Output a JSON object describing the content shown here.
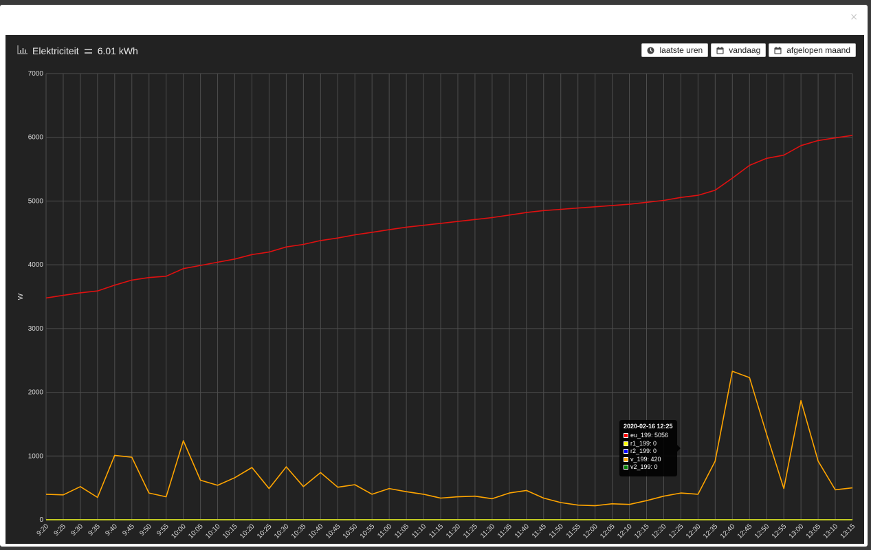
{
  "header": {
    "title": "Elektriciteit",
    "total": "6.01 kWh"
  },
  "buttons": [
    {
      "label": "laatste uren",
      "icon": "clock-icon"
    },
    {
      "label": "vandaag",
      "icon": "calendar-icon"
    },
    {
      "label": "afgelopen maand",
      "icon": "calendar-icon"
    }
  ],
  "close_label": "×",
  "tooltip": {
    "title": "2020-02-16 12:25",
    "rows": [
      {
        "label": "eu_199: 5056",
        "color": "#ff0000"
      },
      {
        "label": "r1_199: 0",
        "color": "#ffff00"
      },
      {
        "label": "r2_199: 0",
        "color": "#0000ff"
      },
      {
        "label": "v_199: 420",
        "color": "#ffa500"
      },
      {
        "label": "v2_199: 0",
        "color": "#008000"
      }
    ]
  },
  "chart_data": {
    "type": "line",
    "ylabel": "W",
    "xlabel": "",
    "ylim": [
      0,
      7000
    ],
    "yticks": [
      0,
      1000,
      2000,
      3000,
      4000,
      5000,
      6000,
      7000
    ],
    "grid": true,
    "x": [
      "9:20",
      "9:25",
      "9:30",
      "9:35",
      "9:40",
      "9:45",
      "9:50",
      "9:55",
      "10:00",
      "10:05",
      "10:10",
      "10:15",
      "10:20",
      "10:25",
      "10:30",
      "10:35",
      "10:40",
      "10:45",
      "10:50",
      "10:55",
      "11:00",
      "11:05",
      "11:10",
      "11:15",
      "11:20",
      "11:25",
      "11:30",
      "11:35",
      "11:40",
      "11:45",
      "11:50",
      "11:55",
      "12:00",
      "12:05",
      "12:10",
      "12:15",
      "12:20",
      "12:25",
      "12:30",
      "12:35",
      "12:40",
      "12:45",
      "12:50",
      "12:55",
      "13:00",
      "13:05",
      "13:10",
      "13:15"
    ],
    "series": [
      {
        "name": "eu_199",
        "color": "#e01010",
        "values": [
          3480,
          3520,
          3560,
          3590,
          3680,
          3760,
          3800,
          3820,
          3940,
          3990,
          4040,
          4090,
          4160,
          4200,
          4280,
          4320,
          4380,
          4420,
          4470,
          4510,
          4550,
          4590,
          4620,
          4650,
          4680,
          4710,
          4740,
          4780,
          4820,
          4850,
          4870,
          4890,
          4910,
          4930,
          4950,
          4980,
          5010,
          5056,
          5090,
          5170,
          5360,
          5560,
          5670,
          5720,
          5870,
          5950,
          5990,
          6030
        ]
      },
      {
        "name": "r1_199",
        "color": "#ffff00",
        "values": [
          0,
          0,
          0,
          0,
          0,
          0,
          0,
          0,
          0,
          0,
          0,
          0,
          0,
          0,
          0,
          0,
          0,
          0,
          0,
          0,
          0,
          0,
          0,
          0,
          0,
          0,
          0,
          0,
          0,
          0,
          0,
          0,
          0,
          0,
          0,
          0,
          0,
          0,
          0,
          0,
          0,
          0,
          0,
          0,
          0,
          0,
          0,
          0
        ]
      },
      {
        "name": "r2_199",
        "color": "#0000ff",
        "values": [
          0,
          0,
          0,
          0,
          0,
          0,
          0,
          0,
          0,
          0,
          0,
          0,
          0,
          0,
          0,
          0,
          0,
          0,
          0,
          0,
          0,
          0,
          0,
          0,
          0,
          0,
          0,
          0,
          0,
          0,
          0,
          0,
          0,
          0,
          0,
          0,
          0,
          0,
          0,
          0,
          0,
          0,
          0,
          0,
          0,
          0,
          0,
          0
        ]
      },
      {
        "name": "v_199",
        "color": "#ffa500",
        "values": [
          400,
          390,
          520,
          350,
          1010,
          980,
          420,
          360,
          1240,
          620,
          540,
          660,
          820,
          490,
          830,
          520,
          740,
          510,
          550,
          400,
          490,
          440,
          400,
          340,
          360,
          370,
          330,
          420,
          460,
          340,
          270,
          230,
          220,
          250,
          240,
          300,
          370,
          420,
          400,
          920,
          2330,
          2230,
          1340,
          490,
          1870,
          920,
          470,
          500
        ]
      },
      {
        "name": "v2_199",
        "color": "#008000",
        "values": [
          0,
          0,
          0,
          0,
          0,
          0,
          0,
          0,
          0,
          0,
          0,
          0,
          0,
          0,
          0,
          0,
          0,
          0,
          0,
          0,
          0,
          0,
          0,
          0,
          0,
          0,
          0,
          0,
          0,
          0,
          0,
          0,
          0,
          0,
          0,
          0,
          0,
          0,
          0,
          0,
          0,
          0,
          0,
          0,
          0,
          0,
          0,
          0
        ]
      }
    ]
  }
}
